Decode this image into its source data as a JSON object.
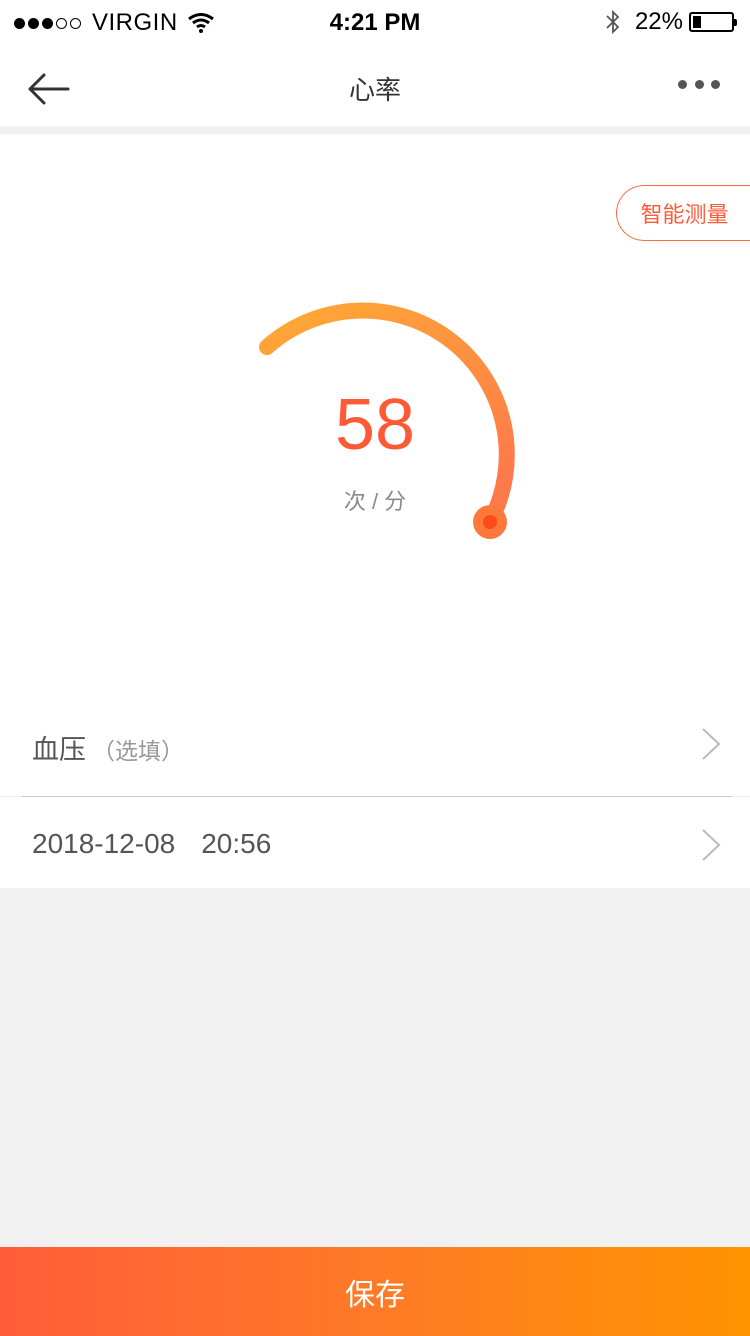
{
  "status_bar": {
    "carrier": "VIRGIN",
    "signal_bars_filled": 3,
    "signal_bars_total": 5,
    "time": "4:21 PM",
    "battery_percent_text": "22%",
    "battery_level": 0.22
  },
  "nav": {
    "title": "心率",
    "back_icon": "arrow-left-icon",
    "more_icon": "more-dots-icon"
  },
  "measure": {
    "smart_button_label": "智能测量",
    "value": "58",
    "unit": "次 / 分",
    "gauge_fill_fraction": 0.45
  },
  "rows": {
    "blood_pressure_label": "血压",
    "blood_pressure_optional": "（选填）",
    "date": "2018-12-08",
    "time": "20:56"
  },
  "footer": {
    "save_label": "保存"
  },
  "colors": {
    "accent": "#ff5a36",
    "gauge_start": "#ffa935",
    "gauge_end": "#ff7a4a",
    "save_gradient_start": "#ff5d3a",
    "save_gradient_end": "#ff9400"
  }
}
